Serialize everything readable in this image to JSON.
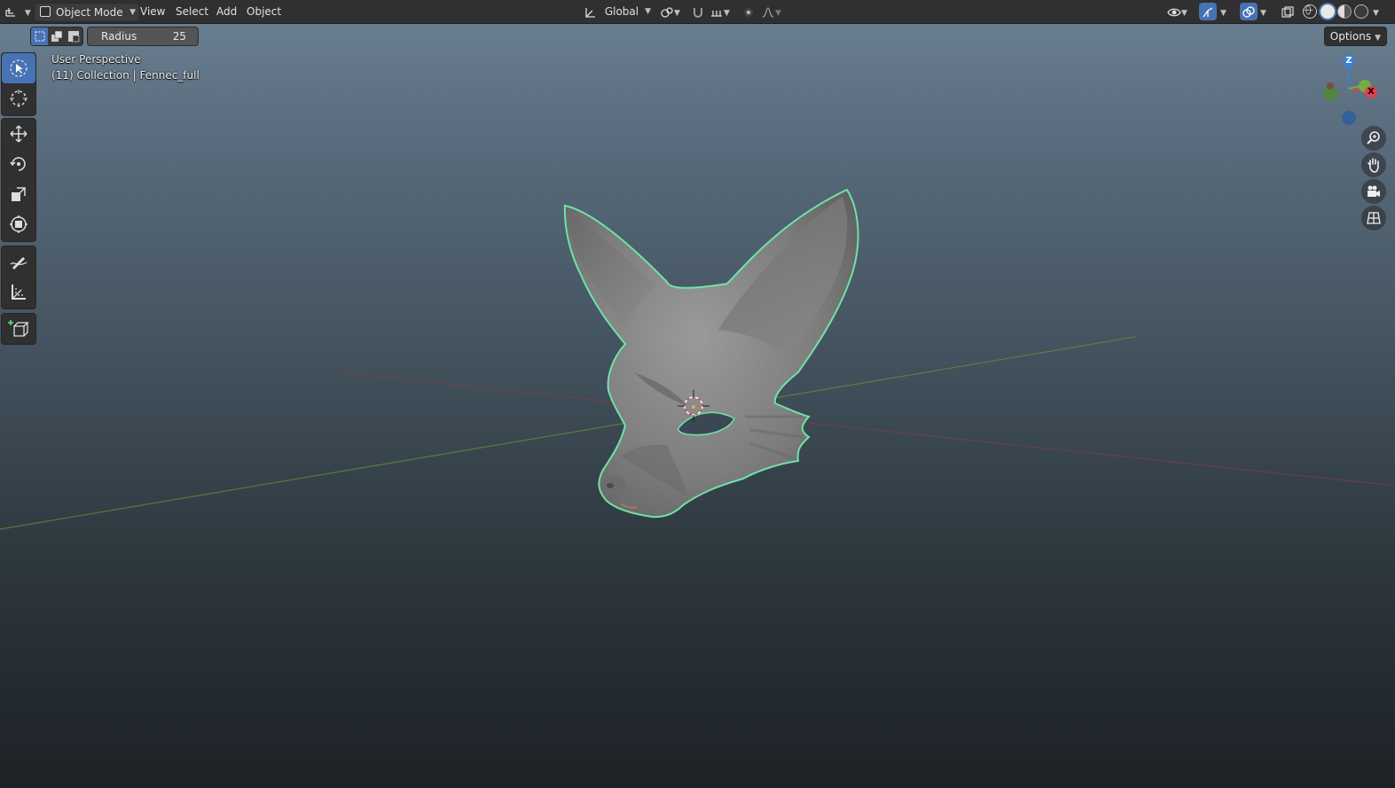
{
  "header": {
    "mode_label": "Object Mode",
    "menus": [
      "View",
      "Select",
      "Add",
      "Object"
    ],
    "orientation_label": "Global"
  },
  "tool_header": {
    "radius_label": "Radius",
    "radius_value": "25",
    "options_label": "Options"
  },
  "viewport": {
    "view_name": "User Perspective",
    "collection_info": "(11) Collection | Fennec_full"
  },
  "gizmo": {
    "z_label": "Z",
    "x_label": "X"
  },
  "icons": {
    "editor_type": "editor-type-icon",
    "tools": [
      "select-box-icon",
      "cursor-icon",
      "move-icon",
      "rotate-icon",
      "scale-icon",
      "transform-icon",
      "annotate-icon",
      "measure-icon",
      "add-cube-icon"
    ],
    "nav": [
      "zoom-icon",
      "pan-hand-icon",
      "camera-icon",
      "grid-ortho-icon"
    ]
  },
  "colors": {
    "accent": "#4772b3",
    "selection_outline": "#6ee3a8",
    "x_axis": "#e0414f",
    "y_axis": "#72b043",
    "z_axis": "#3d7fd4"
  }
}
